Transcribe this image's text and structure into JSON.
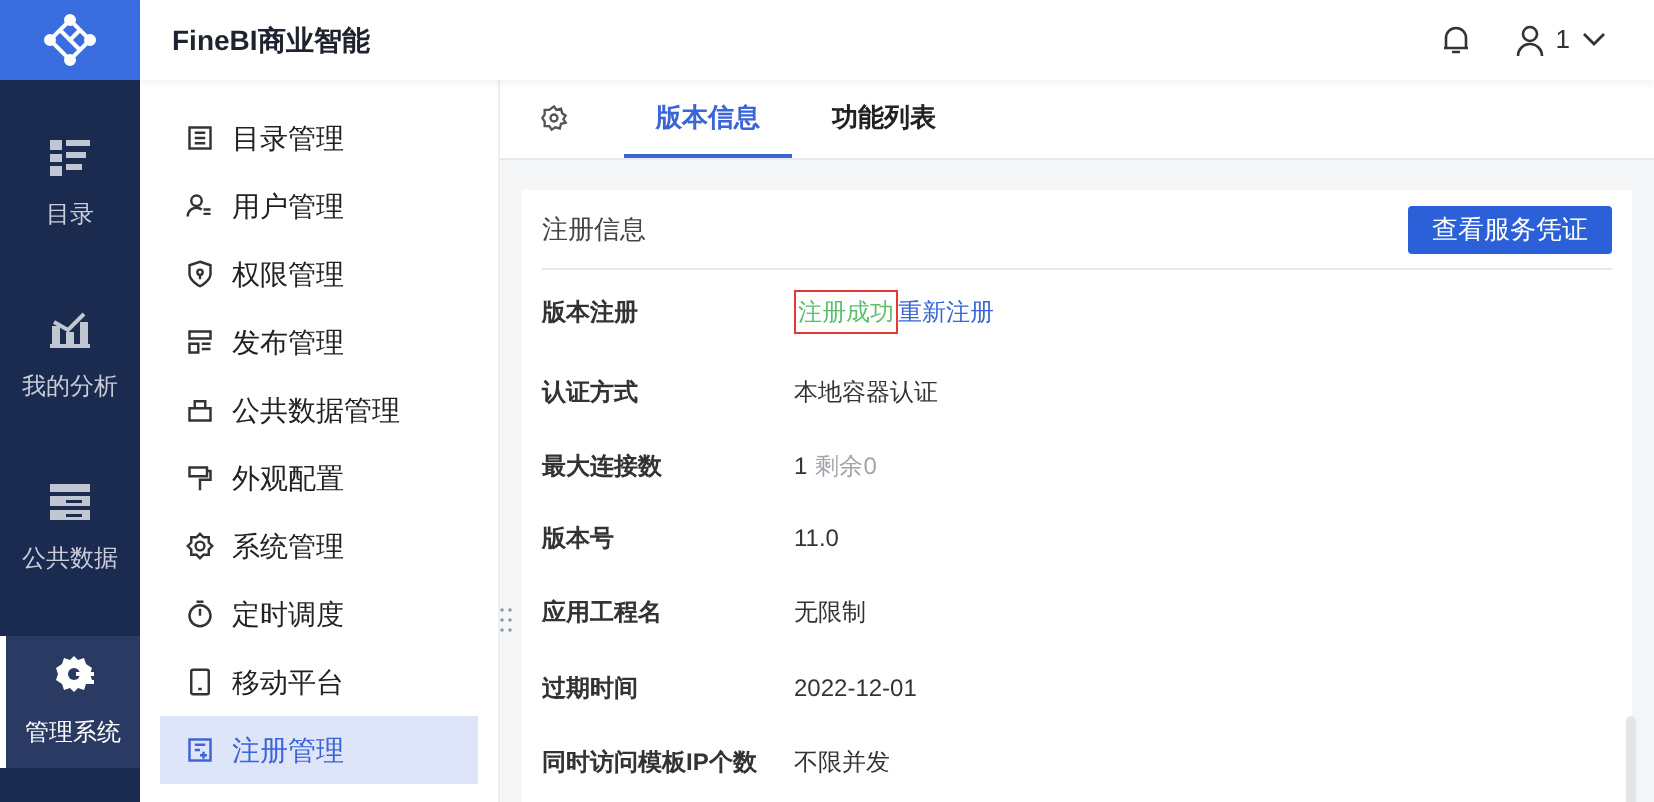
{
  "app": {
    "title": "FineBI商业智能",
    "user": "1"
  },
  "rail": [
    {
      "label": "目录",
      "selected": false
    },
    {
      "label": "我的分析",
      "selected": false
    },
    {
      "label": "公共数据",
      "selected": false
    },
    {
      "label": "管理系统",
      "selected": true
    }
  ],
  "menu": [
    {
      "label": "目录管理",
      "selected": false
    },
    {
      "label": "用户管理",
      "selected": false
    },
    {
      "label": "权限管理",
      "selected": false
    },
    {
      "label": "发布管理",
      "selected": false
    },
    {
      "label": "公共数据管理",
      "selected": false
    },
    {
      "label": "外观配置",
      "selected": false
    },
    {
      "label": "系统管理",
      "selected": false
    },
    {
      "label": "定时调度",
      "selected": false
    },
    {
      "label": "移动平台",
      "selected": false
    },
    {
      "label": "注册管理",
      "selected": true
    }
  ],
  "tabs": [
    {
      "label": "版本信息",
      "selected": true
    },
    {
      "label": "功能列表",
      "selected": false
    }
  ],
  "card": {
    "title": "注册信息",
    "button": "查看服务凭证",
    "rows": [
      {
        "label": "版本注册",
        "values": [
          {
            "text": "注册成功",
            "kind": "success",
            "highlighted": true
          },
          {
            "text": "重新注册",
            "kind": "link",
            "highlighted": false
          }
        ]
      },
      {
        "label": "认证方式",
        "values": [
          {
            "text": "本地容器认证",
            "kind": "text",
            "highlighted": false
          }
        ]
      },
      {
        "label": "最大连接数",
        "values": [
          {
            "text": "1",
            "kind": "text",
            "highlighted": false
          },
          {
            "text": "剩余0",
            "kind": "muted",
            "highlighted": false
          }
        ]
      },
      {
        "label": "版本号",
        "values": [
          {
            "text": "11.0",
            "kind": "text",
            "highlighted": false
          }
        ]
      },
      {
        "label": "应用工程名",
        "values": [
          {
            "text": "无限制",
            "kind": "text",
            "highlighted": false
          }
        ]
      },
      {
        "label": "过期时间",
        "values": [
          {
            "text": "2022-12-01",
            "kind": "text",
            "highlighted": false
          }
        ]
      },
      {
        "label": "同时访问模板IP个数",
        "values": [
          {
            "text": "不限并发",
            "kind": "text",
            "highlighted": false
          }
        ]
      }
    ]
  }
}
